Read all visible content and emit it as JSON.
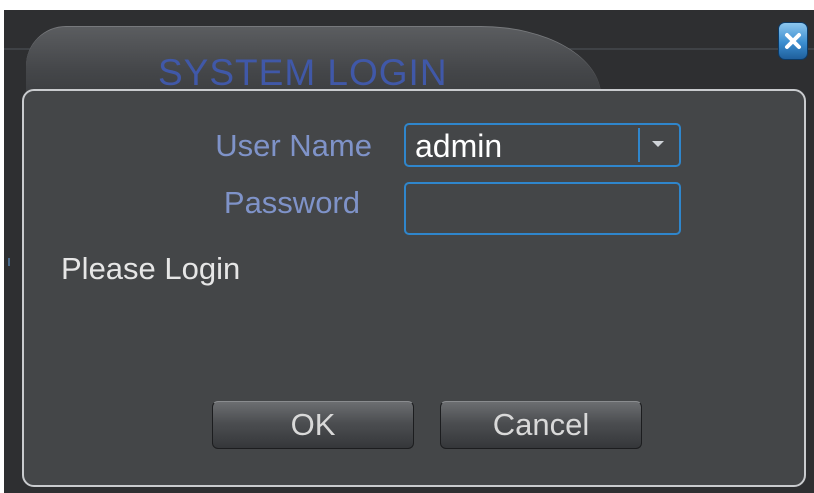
{
  "dialog": {
    "title": "SYSTEM LOGIN",
    "close_icon": "close-icon"
  },
  "form": {
    "username_label": "User Name",
    "username_value": "admin",
    "username_dropdown_icon": "chevron-down-icon",
    "password_label": "Password",
    "password_value": ""
  },
  "status": {
    "message": "Please Login"
  },
  "buttons": {
    "ok_label": "OK",
    "cancel_label": "Cancel"
  },
  "colors": {
    "title": "#4058a8",
    "label": "#7f93c9",
    "field_border": "#2f86cc",
    "panel_bg": "#444648"
  }
}
